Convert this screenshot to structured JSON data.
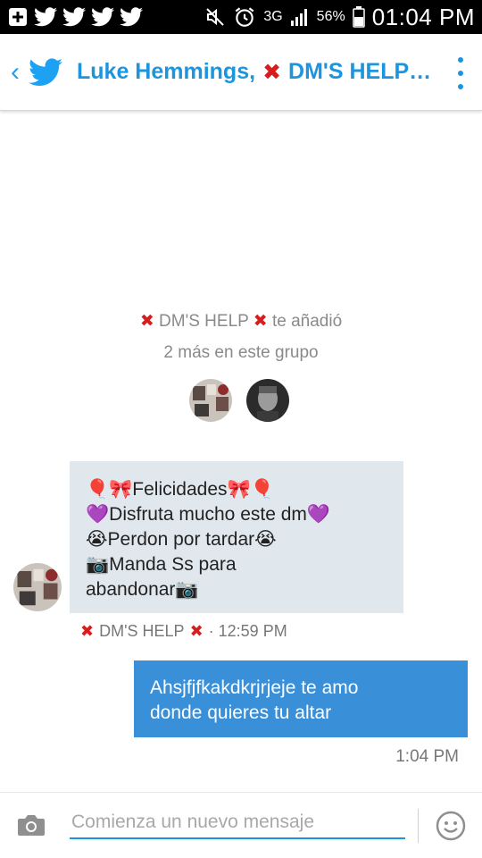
{
  "status_bar": {
    "network": "3G",
    "battery": "56%",
    "time": "01:04 PM"
  },
  "header": {
    "title_prefix": "Luke Hemmings,",
    "title_suffix": "DM'S HELP…"
  },
  "system_message": {
    "actor_name": "DM'S HELP",
    "action_text": "te añadió",
    "group_count_text": "2 más en este grupo"
  },
  "incoming_message": {
    "lines": [
      "🎈🎀Felicidades🎀🎈",
      "💜Disfruta mucho este dm💜",
      "😭Perdon por tardar😭",
      "📷Manda Ss para",
      "abandonar📷"
    ],
    "sender": "DM'S HELP",
    "time": "· 12:59 PM"
  },
  "outgoing_message": {
    "line1": "Ahsjfjfkakdkrjrjeje te amo",
    "line2": "donde quieres tu altar",
    "time": "1:04 PM"
  },
  "composer": {
    "placeholder": "Comienza un nuevo mensaje"
  },
  "colors": {
    "accent": "#1b95e0",
    "outgoing_bubble": "#3a8fd9",
    "incoming_bubble": "#e1e8ed",
    "cross": "#d71e1e"
  }
}
